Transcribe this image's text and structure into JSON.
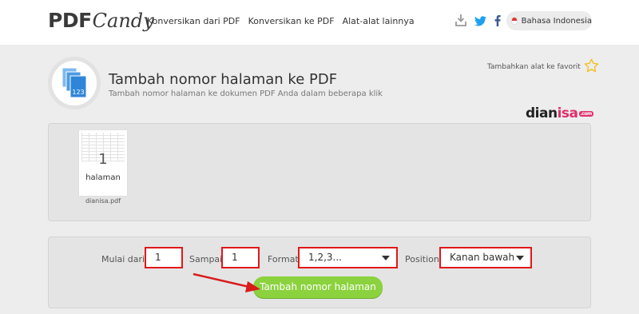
{
  "header": {
    "logo_pdf": "PDF",
    "logo_candy": "Candy",
    "nav": [
      "Konversikan dari PDF",
      "Konversikan ke PDF",
      "Alat-alat lainnya"
    ],
    "language": "Bahasa Indonesia",
    "icons": [
      "download-icon",
      "twitter-icon",
      "facebook-icon",
      "indonesia-flag-icon"
    ]
  },
  "tool": {
    "title": "Tambah nomor halaman ke PDF",
    "subtitle": "Tambah nomor halaman ke dokumen PDF Anda dalam beberapa klik",
    "favorite": "Tambahkan alat ke favorit",
    "icon_badge": "123"
  },
  "watermark": {
    "part1": "dian",
    "part2": "isa",
    "part3": ".com"
  },
  "file": {
    "page_number": "1",
    "page_word": "halaman",
    "name": "dianisa.pdf"
  },
  "options": {
    "from_label": "Mulai dari:",
    "from_value": "1",
    "to_label": "Sampai:",
    "to_value": "1",
    "format_label": "Format:",
    "format_value": "1,2,3...",
    "position_label": "Position:",
    "position_value": "Kanan bawah",
    "submit": "Tambah nomor halaman"
  },
  "colors": {
    "accent_green": "#8bd23e",
    "highlight_red": "#e01818",
    "twitter_blue": "#1da1f2",
    "facebook_blue": "#3b5998",
    "icon_blue": "#2f86d8"
  }
}
